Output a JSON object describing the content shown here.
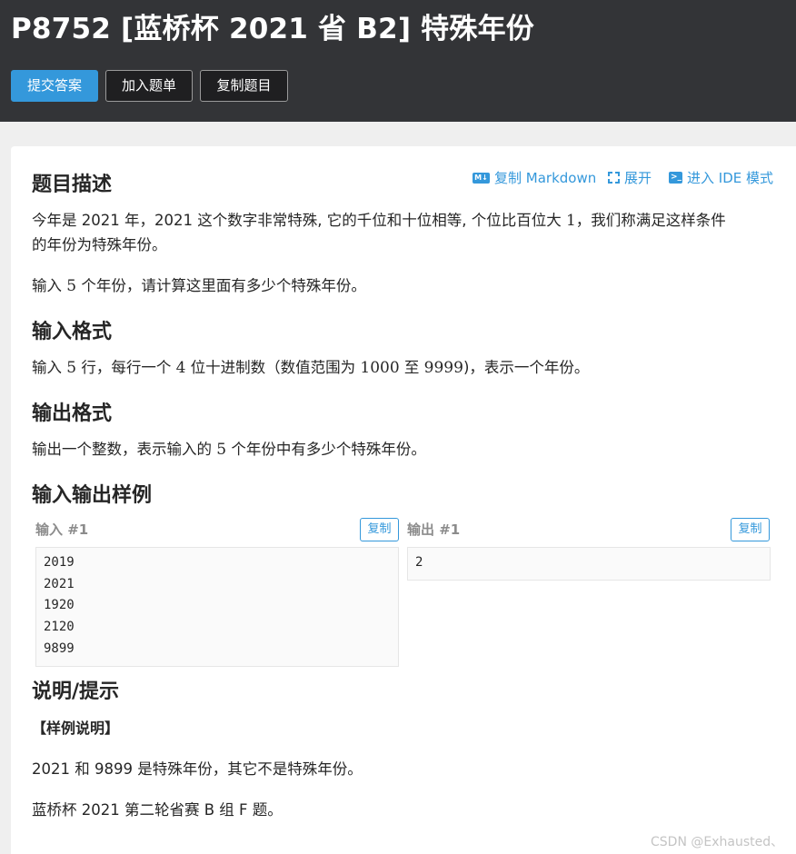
{
  "header": {
    "title": "P8752 [蓝桥杯 2021 省 B2] 特殊年份",
    "buttons": {
      "submit": "提交答案",
      "add_to_list": "加入题单",
      "copy_problem": "复制题目"
    }
  },
  "toolbar": {
    "copy_markdown": "复制 Markdown",
    "expand": "展开",
    "ide_mode": "进入 IDE 模式",
    "md_badge": "M↓"
  },
  "description": {
    "heading": "题目描述",
    "p1_line1_a": "今年是 2021 年，2021 这个数字非常特殊, 它的千位和十位相等, 个位比百位大 ",
    "p1_line1_num": "1",
    "p1_line1_b": "，我们称满足这样条件",
    "p1_line2": "的年份为特殊年份。",
    "p2_a": "输入 ",
    "p2_num": "5",
    "p2_b": " 个年份，请计算这里面有多少个特殊年份。"
  },
  "input_format": {
    "heading": "输入格式",
    "t1": "输入 ",
    "n1": "5",
    "t2": " 行，每行一个 ",
    "n2": "4",
    "t3": " 位十进制数（数值范围为 ",
    "n3": "1000",
    "t4": " 至 ",
    "n4": "9999",
    "t5": ")，表示一个年份。"
  },
  "output_format": {
    "heading": "输出格式",
    "t1": "输出一个整数，表示输入的 ",
    "n1": "5",
    "t2": " 个年份中有多少个特殊年份。"
  },
  "samples": {
    "heading": "输入输出样例",
    "input_label": "输入 #1",
    "output_label": "输出 #1",
    "copy_label": "复制",
    "input_lines": [
      "2019",
      "2021",
      "1920",
      "2120",
      "9899"
    ],
    "output_lines": [
      "2"
    ]
  },
  "hint": {
    "heading": "说明/提示",
    "sub": "【样例说明】",
    "line1": "2021 和 9899 是特殊年份，其它不是特殊年份。",
    "line2": "蓝桥杯 2021 第二轮省赛 B 组 F 题。"
  },
  "watermark": "CSDN @Exhausted、"
}
